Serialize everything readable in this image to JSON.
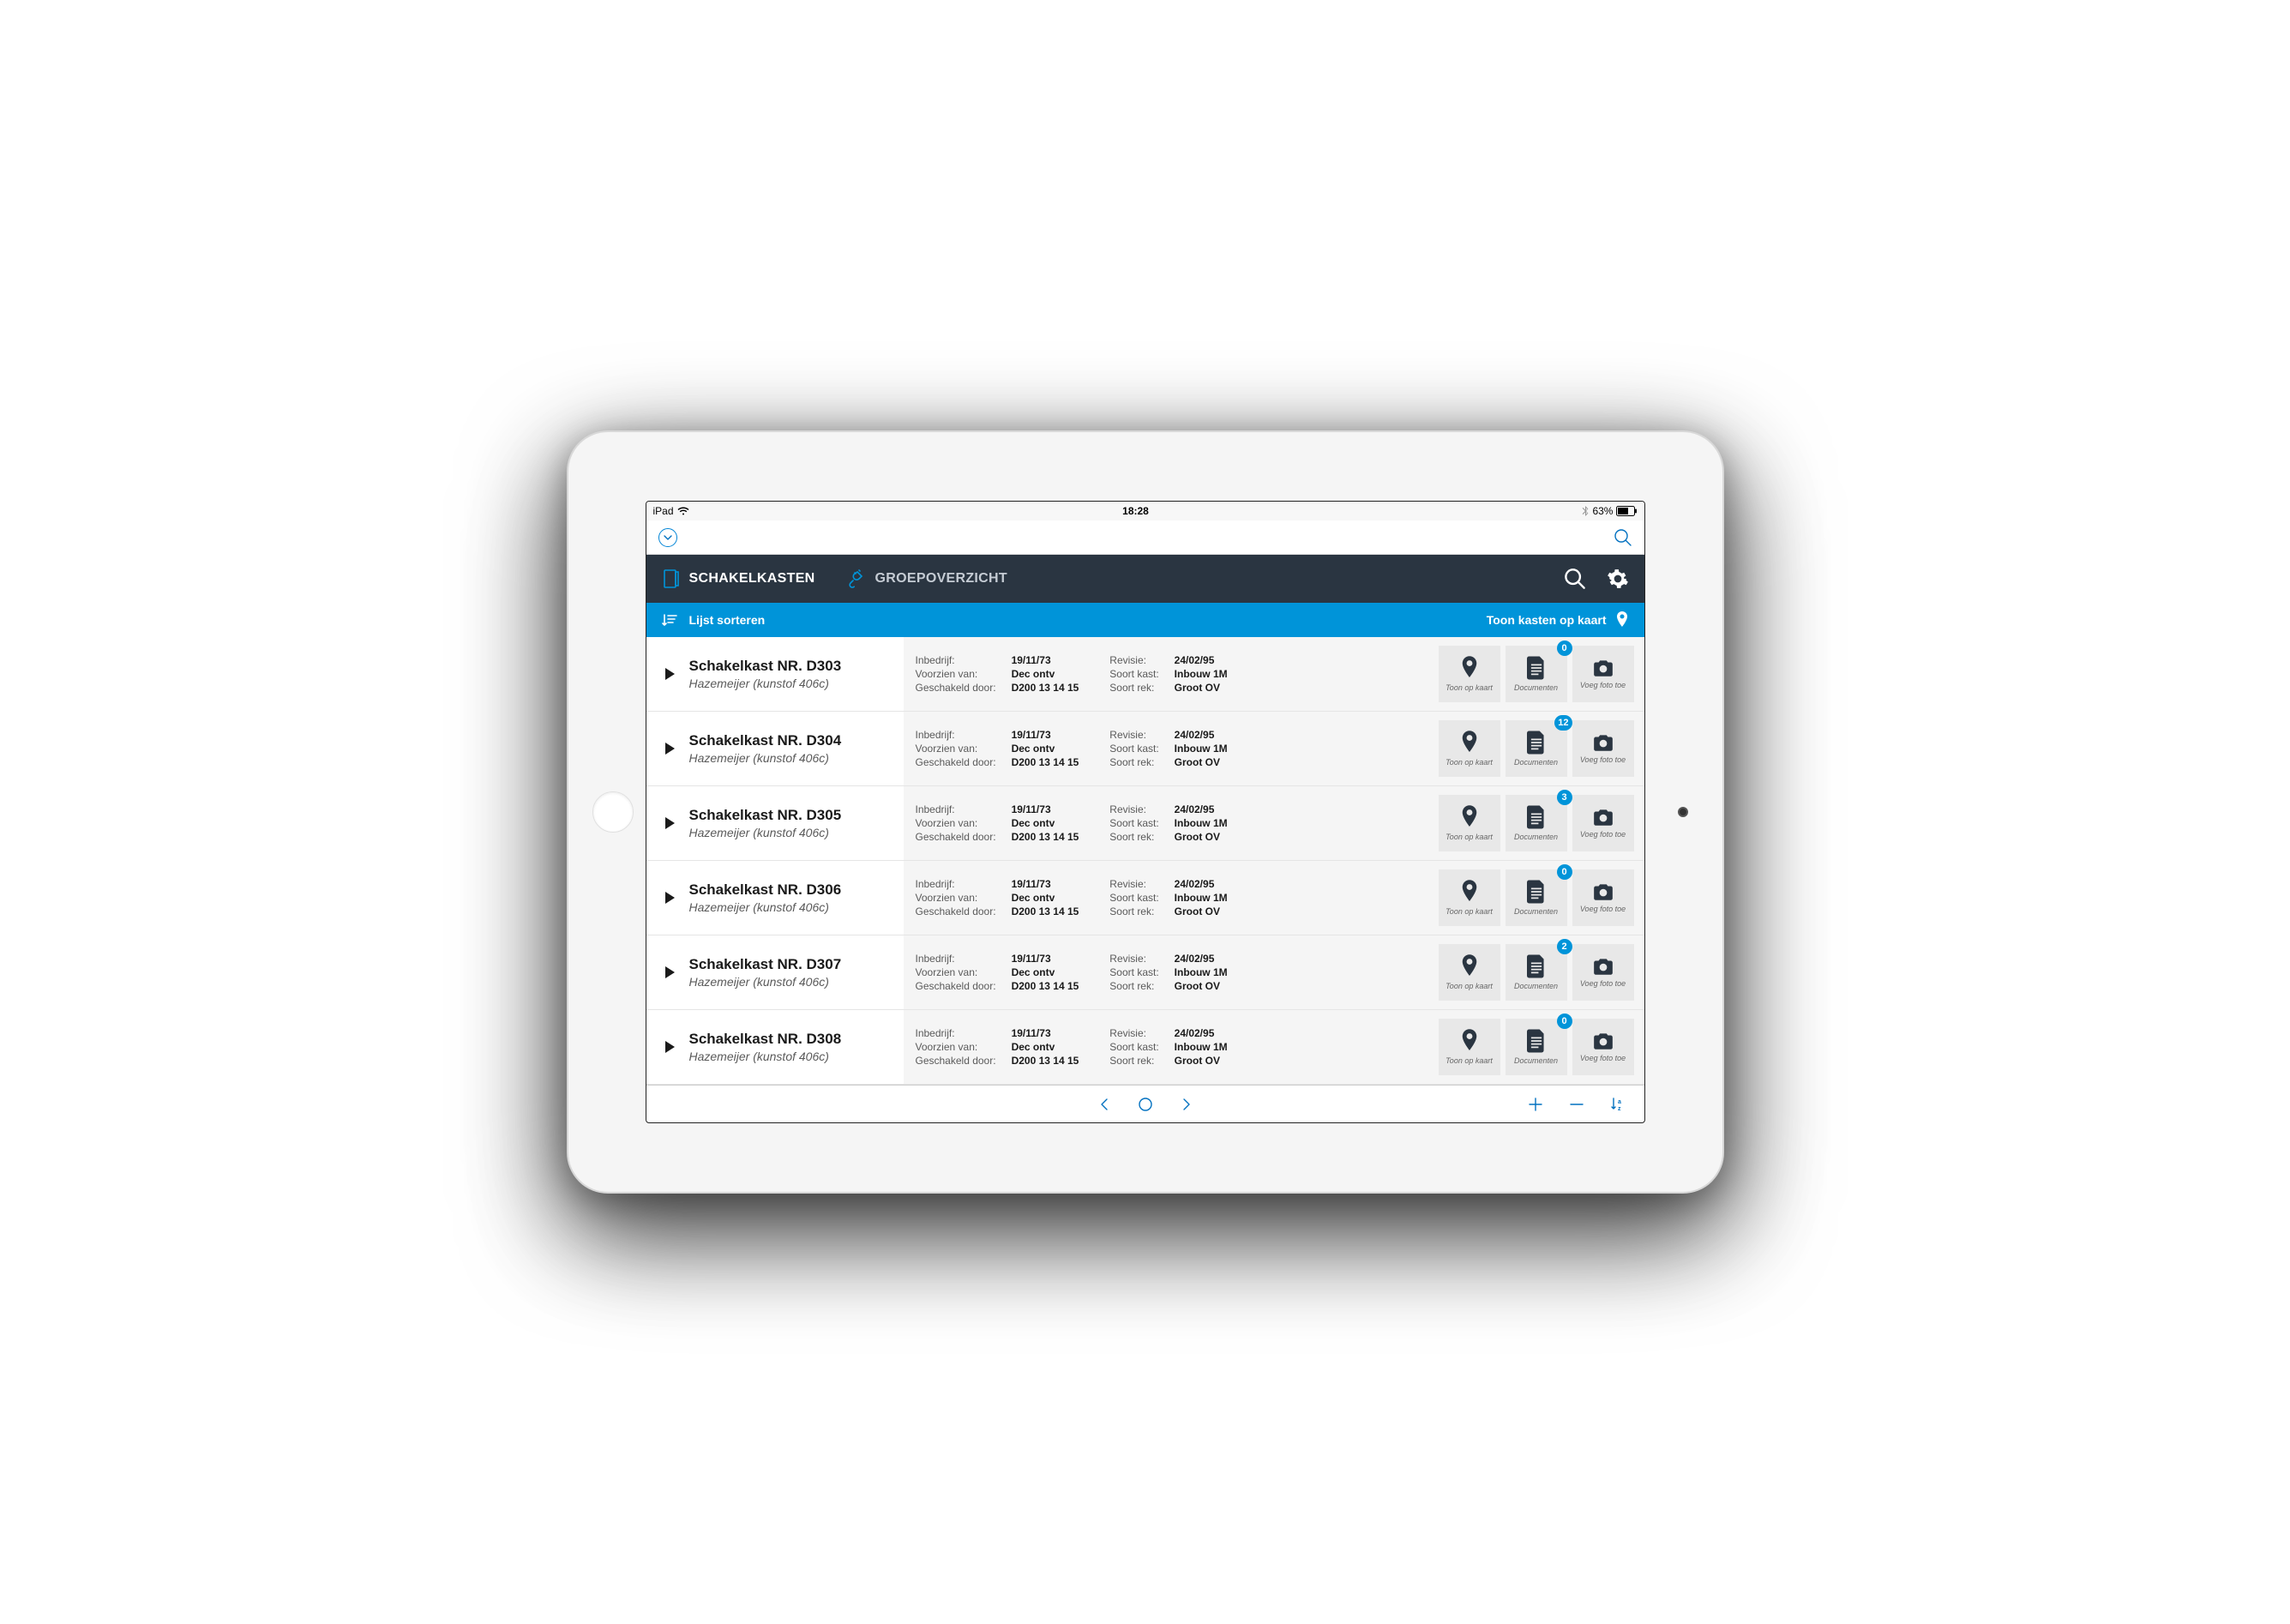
{
  "status_bar": {
    "device": "iPad",
    "time": "18:28",
    "battery": "63%"
  },
  "top_toolbar": {},
  "nav": {
    "tab1_label": "SCHAKELKASTEN",
    "tab2_label": "GROEPOVERZICHT"
  },
  "sort_bar": {
    "sort_label": "Lijst sorteren",
    "map_label": "Toon kasten op kaart"
  },
  "field_labels": {
    "inbedrijf": "Inbedrijf:",
    "voorzien": "Voorzien van:",
    "geschakeld": "Geschakeld door:",
    "revisie": "Revisie:",
    "soort_kast": "Soort kast:",
    "soort_rek": "Soort rek:"
  },
  "action_labels": {
    "map": "Toon op kaart",
    "docs": "Documenten",
    "photo": "Voeg foto toe"
  },
  "rows": [
    {
      "title": "Schakelkast NR. D303",
      "sub": "Hazemeijer (kunstof 406c)",
      "inbedrijf": "19/11/73",
      "voorzien": "Dec ontv",
      "geschakeld": "D200 13 14 15",
      "revisie": "24/02/95",
      "soort_kast": "Inbouw 1M",
      "soort_rek": "Groot OV",
      "doc_count": 0
    },
    {
      "title": "Schakelkast NR. D304",
      "sub": "Hazemeijer (kunstof 406c)",
      "inbedrijf": "19/11/73",
      "voorzien": "Dec ontv",
      "geschakeld": "D200 13 14 15",
      "revisie": "24/02/95",
      "soort_kast": "Inbouw 1M",
      "soort_rek": "Groot OV",
      "doc_count": 12
    },
    {
      "title": "Schakelkast NR. D305",
      "sub": "Hazemeijer (kunstof 406c)",
      "inbedrijf": "19/11/73",
      "voorzien": "Dec ontv",
      "geschakeld": "D200 13 14 15",
      "revisie": "24/02/95",
      "soort_kast": "Inbouw 1M",
      "soort_rek": "Groot OV",
      "doc_count": 3
    },
    {
      "title": "Schakelkast NR. D306",
      "sub": "Hazemeijer (kunstof 406c)",
      "inbedrijf": "19/11/73",
      "voorzien": "Dec ontv",
      "geschakeld": "D200 13 14 15",
      "revisie": "24/02/95",
      "soort_kast": "Inbouw 1M",
      "soort_rek": "Groot OV",
      "doc_count": 0
    },
    {
      "title": "Schakelkast NR. D307",
      "sub": "Hazemeijer (kunstof 406c)",
      "inbedrijf": "19/11/73",
      "voorzien": "Dec ontv",
      "geschakeld": "D200 13 14 15",
      "revisie": "24/02/95",
      "soort_kast": "Inbouw 1M",
      "soort_rek": "Groot OV",
      "doc_count": 2
    },
    {
      "title": "Schakelkast NR. D308",
      "sub": "Hazemeijer (kunstof 406c)",
      "inbedrijf": "19/11/73",
      "voorzien": "Dec ontv",
      "geschakeld": "D200 13 14 15",
      "revisie": "24/02/95",
      "soort_kast": "Inbouw 1M",
      "soort_rek": "Groot OV",
      "doc_count": 0
    }
  ]
}
